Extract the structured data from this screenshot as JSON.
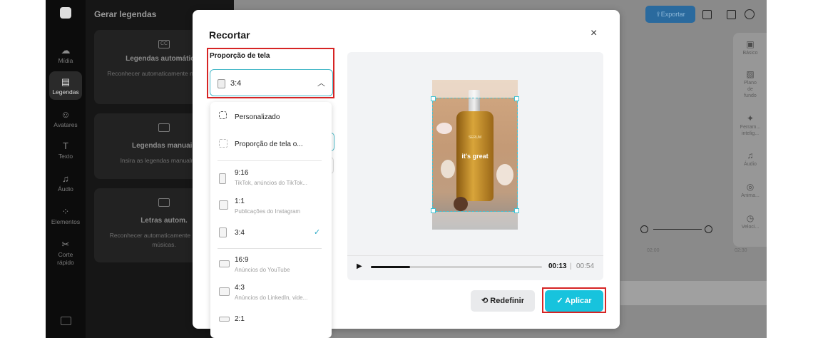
{
  "app": {
    "left_nav": [
      {
        "label": "Mídia",
        "icon": "cloud-upload-icon"
      },
      {
        "label": "Legendas",
        "icon": "captions-icon",
        "active": true
      },
      {
        "label": "Avatares",
        "icon": "avatar-icon"
      },
      {
        "label": "Texto",
        "icon": "text-icon"
      },
      {
        "label": "Áudio",
        "icon": "music-note-icon"
      },
      {
        "label": "Elementos",
        "icon": "elements-icon"
      },
      {
        "label": "Corte rápido",
        "icon": "scissors-icon"
      }
    ],
    "panel": {
      "title": "Gerar legendas",
      "cards": [
        {
          "title": "Legendas automáticas",
          "desc": "Reconhecer automaticamente nos vídeos."
        },
        {
          "title": "Legendas manuais",
          "desc": "Insira as legendas manualmente"
        },
        {
          "title": "Letras autom.",
          "desc": "Reconhecer automaticamente letras das músicas."
        }
      ]
    },
    "export_label": "Exportar",
    "right_panel": [
      {
        "label": "Básico",
        "icon": "film-icon"
      },
      {
        "label": "Plano de fundo",
        "icon": "background-icon"
      },
      {
        "label": "Ferram... intelig...",
        "icon": "magic-wand-icon"
      },
      {
        "label": "Áudio",
        "icon": "music-note-icon"
      },
      {
        "label": "Anima...",
        "icon": "animation-icon"
      },
      {
        "label": "Veloci...",
        "icon": "speed-icon"
      }
    ],
    "timeline_ticks": [
      "02:00",
      "02:30"
    ]
  },
  "modal": {
    "title": "Recortar",
    "close_glyph": "×",
    "ratio_label": "Proporção de tela",
    "selected_ratio": "3:4",
    "options": [
      {
        "label": "Personalizado",
        "sub": ""
      },
      {
        "label": "Proporção de tela o...",
        "sub": ""
      },
      {
        "label": "9:16",
        "sub": "TikTok, anúncios do TikTok..."
      },
      {
        "label": "1:1",
        "sub": "Publicações do Instagram"
      },
      {
        "label": "3:4",
        "sub": "",
        "selected": true
      },
      {
        "label": "16:9",
        "sub": "Anúncios do YouTube"
      },
      {
        "label": "4:3",
        "sub": "Anúncios do LinkedIn, vide..."
      },
      {
        "label": "2:1",
        "sub": ""
      }
    ],
    "video": {
      "title_text": "it's great",
      "brand_small": "SERUM"
    },
    "player": {
      "current_time": "00:13",
      "separator": "|",
      "total_time": "00:54",
      "progress": 0.23
    },
    "reset_label": "Redefinir",
    "apply_label": "Aplicar",
    "colors": {
      "accent": "#17c3dd",
      "highlight": "#d62424"
    }
  }
}
